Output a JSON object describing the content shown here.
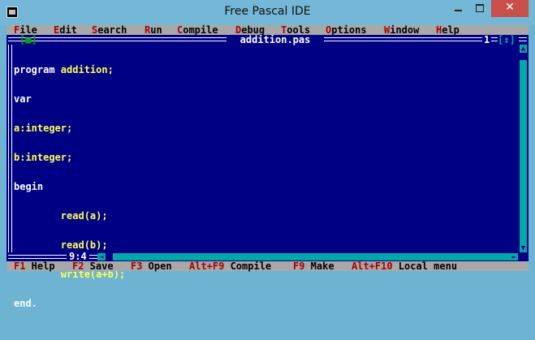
{
  "window": {
    "title": "Free Pascal IDE",
    "close_glyph": "✕"
  },
  "menu": {
    "items": [
      {
        "hotkey": "F",
        "rest": "ile"
      },
      {
        "hotkey": "E",
        "rest": "dit"
      },
      {
        "hotkey": "S",
        "rest": "earch"
      },
      {
        "hotkey": "R",
        "rest": "un"
      },
      {
        "hotkey": "C",
        "rest": "ompile"
      },
      {
        "hotkey": "D",
        "rest": "ebug"
      },
      {
        "hotkey": "T",
        "rest": "ools"
      },
      {
        "hotkey": "O",
        "rest": "ptions"
      },
      {
        "hotkey": "W",
        "rest": "indow"
      },
      {
        "hotkey": "H",
        "rest": "elp"
      }
    ]
  },
  "editor": {
    "file_name": "addition.pas",
    "close_box": "[■]",
    "window_number": "1",
    "zoom_box": "[↕]",
    "cursor_position": "9:4",
    "code_lines": [
      {
        "a": "program ",
        "b": "addition;"
      },
      {
        "a": "var",
        "b": ""
      },
      {
        "a": "",
        "b": "a:integer;"
      },
      {
        "a": "",
        "b": "b:integer;"
      },
      {
        "a": "begin",
        "b": ""
      },
      {
        "a": "        ",
        "b": "read(a);"
      },
      {
        "a": "        ",
        "b": "read(b);"
      },
      {
        "a": "        ",
        "b": "write(a+b);"
      },
      {
        "a": "end.",
        "b": ""
      }
    ]
  },
  "status_bar": {
    "items": [
      {
        "key": "F1",
        "label": " Help"
      },
      {
        "key": "F2",
        "label": " Save"
      },
      {
        "key": "F3",
        "label": " Open"
      },
      {
        "key": "Alt+F9",
        "label": " Compile"
      },
      {
        "key": "F9",
        "label": " Make"
      },
      {
        "key": "Alt+F10",
        "label": " Local menu"
      }
    ]
  },
  "colors": {
    "editor_bg": "#000084",
    "menu_bg": "#a8a8a8",
    "hotkey": "#a80000",
    "code_keyword": "#ffffff",
    "code_identifier": "#ffff54",
    "scrollbar": "#00a8a8",
    "titlebar": "#74b7d6",
    "close_button": "#c7504a"
  }
}
